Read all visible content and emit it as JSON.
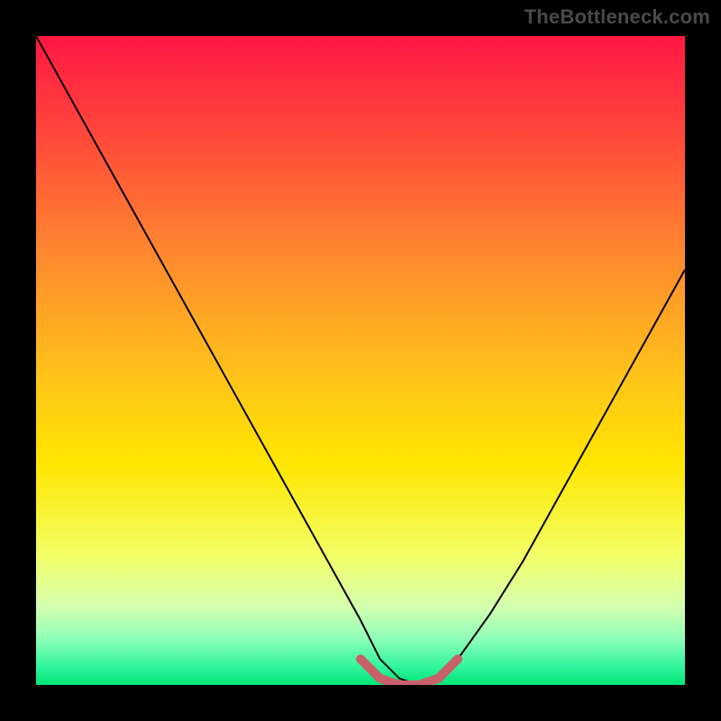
{
  "watermark": {
    "text": "TheBottleneck.com"
  },
  "chart_data": {
    "type": "line",
    "title": "",
    "xlabel": "",
    "ylabel": "",
    "xlim": [
      0,
      100
    ],
    "ylim": [
      0,
      100
    ],
    "grid": false,
    "legend": false,
    "gradient_stops": [
      {
        "pct": 0,
        "color": "#ff1744"
      },
      {
        "pct": 16,
        "color": "#ff4a3a"
      },
      {
        "pct": 34,
        "color": "#ff8a2e"
      },
      {
        "pct": 52,
        "color": "#ffc21a"
      },
      {
        "pct": 66,
        "color": "#ffe600"
      },
      {
        "pct": 80,
        "color": "#f3ff66"
      },
      {
        "pct": 88,
        "color": "#d4ffb0"
      },
      {
        "pct": 93,
        "color": "#8cffb8"
      },
      {
        "pct": 97,
        "color": "#34f5a0"
      },
      {
        "pct": 100,
        "color": "#00e676"
      }
    ],
    "series": [
      {
        "name": "bottleneck-curve",
        "color": "#000000",
        "width": 2,
        "x": [
          0,
          5,
          10,
          15,
          20,
          25,
          30,
          35,
          40,
          45,
          50,
          53,
          56,
          59,
          62,
          65,
          70,
          75,
          80,
          85,
          90,
          95,
          100
        ],
        "y": [
          100,
          91,
          82,
          73,
          64,
          55,
          46,
          37,
          28,
          19,
          10,
          4,
          1,
          0,
          1,
          4,
          11,
          19,
          28,
          37,
          46,
          55,
          64
        ]
      },
      {
        "name": "optimal-marker",
        "color": "#c9606a",
        "width": 10,
        "linecap": "round",
        "x": [
          50,
          53,
          56,
          59,
          62,
          65
        ],
        "y": [
          4,
          1,
          0,
          0,
          1,
          4
        ]
      }
    ]
  }
}
